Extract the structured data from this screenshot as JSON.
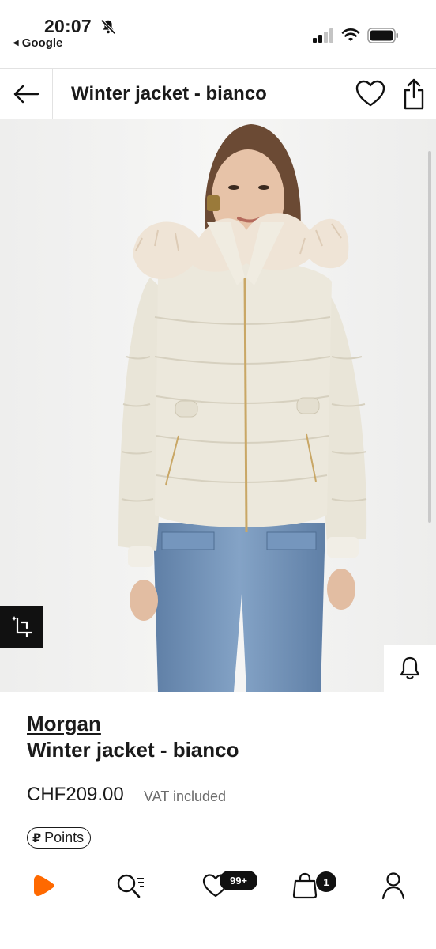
{
  "status_bar": {
    "time": "20:07",
    "back_app": "Google"
  },
  "header": {
    "title": "Winter jacket - bianco"
  },
  "product": {
    "brand": "Morgan",
    "name": "Winter jacket - bianco",
    "price": "CHF209.00",
    "vat_note": "VAT included",
    "points_label": "Points",
    "image_icons": {
      "crop": "image-search-icon",
      "alert": "bell-icon"
    }
  },
  "tabbar": {
    "items": [
      {
        "name": "home",
        "icon": "zalando-logo-icon"
      },
      {
        "name": "search",
        "icon": "search-icon"
      },
      {
        "name": "wishlist",
        "icon": "heart-icon",
        "badge": "99+"
      },
      {
        "name": "bag",
        "icon": "bag-icon",
        "badge": "1"
      },
      {
        "name": "account",
        "icon": "user-icon"
      }
    ]
  },
  "colors": {
    "accent": "#ff6900",
    "text": "#1a1a1a",
    "muted": "#6b6b6b",
    "jacket": "#ece8dc",
    "jeans": "#6f8fb3"
  }
}
